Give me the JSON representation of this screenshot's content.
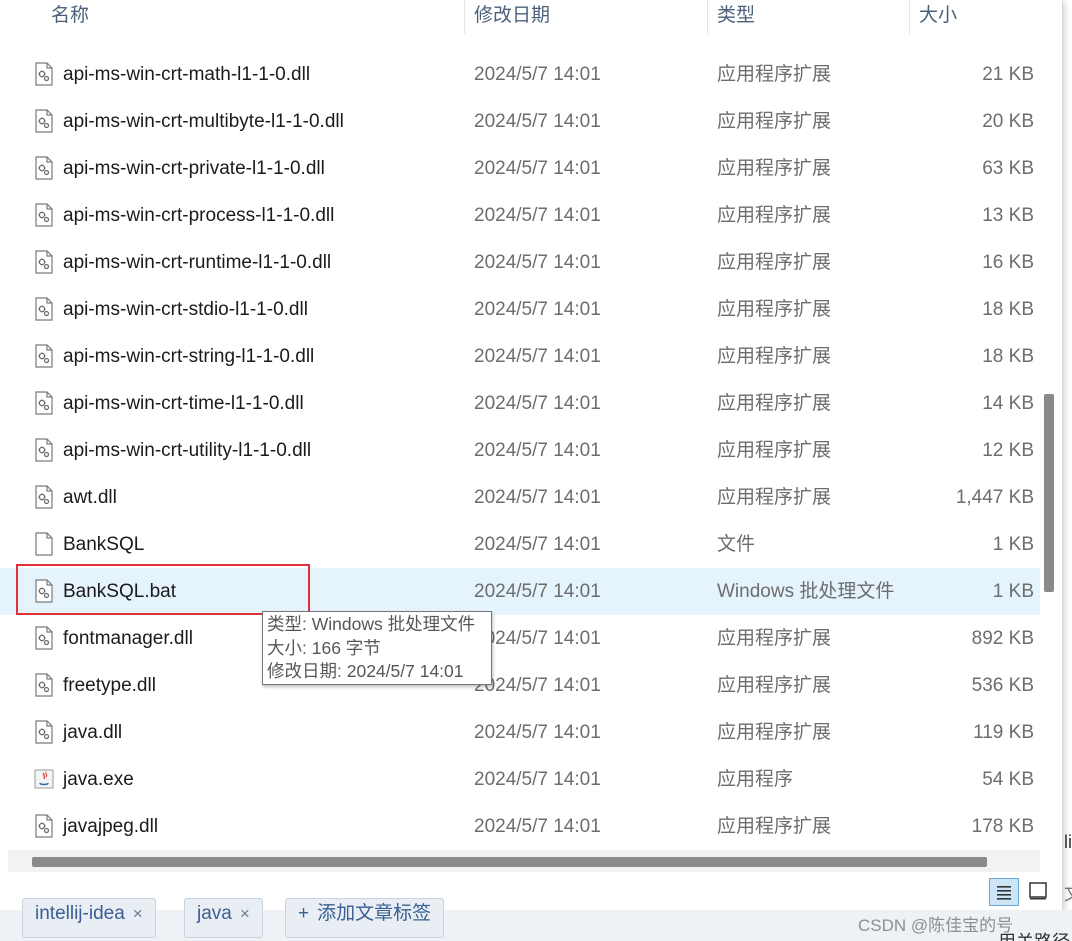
{
  "columns": {
    "name": "名称",
    "date": "修改日期",
    "type": "类型",
    "size": "大小"
  },
  "files": [
    {
      "name": "api-ms-win-crt-math-l1-1-0.dll",
      "date": "2024/5/7 14:01",
      "type": "应用程序扩展",
      "size": "21 KB",
      "icon": "dll-file-icon"
    },
    {
      "name": "api-ms-win-crt-multibyte-l1-1-0.dll",
      "date": "2024/5/7 14:01",
      "type": "应用程序扩展",
      "size": "20 KB",
      "icon": "dll-file-icon"
    },
    {
      "name": "api-ms-win-crt-private-l1-1-0.dll",
      "date": "2024/5/7 14:01",
      "type": "应用程序扩展",
      "size": "63 KB",
      "icon": "dll-file-icon"
    },
    {
      "name": "api-ms-win-crt-process-l1-1-0.dll",
      "date": "2024/5/7 14:01",
      "type": "应用程序扩展",
      "size": "13 KB",
      "icon": "dll-file-icon"
    },
    {
      "name": "api-ms-win-crt-runtime-l1-1-0.dll",
      "date": "2024/5/7 14:01",
      "type": "应用程序扩展",
      "size": "16 KB",
      "icon": "dll-file-icon"
    },
    {
      "name": "api-ms-win-crt-stdio-l1-1-0.dll",
      "date": "2024/5/7 14:01",
      "type": "应用程序扩展",
      "size": "18 KB",
      "icon": "dll-file-icon"
    },
    {
      "name": "api-ms-win-crt-string-l1-1-0.dll",
      "date": "2024/5/7 14:01",
      "type": "应用程序扩展",
      "size": "18 KB",
      "icon": "dll-file-icon"
    },
    {
      "name": "api-ms-win-crt-time-l1-1-0.dll",
      "date": "2024/5/7 14:01",
      "type": "应用程序扩展",
      "size": "14 KB",
      "icon": "dll-file-icon"
    },
    {
      "name": "api-ms-win-crt-utility-l1-1-0.dll",
      "date": "2024/5/7 14:01",
      "type": "应用程序扩展",
      "size": "12 KB",
      "icon": "dll-file-icon"
    },
    {
      "name": "awt.dll",
      "date": "2024/5/7 14:01",
      "type": "应用程序扩展",
      "size": "1,447 KB",
      "icon": "dll-file-icon"
    },
    {
      "name": "BankSQL",
      "date": "2024/5/7 14:01",
      "type": "文件",
      "size": "1 KB",
      "icon": "blank-file-icon"
    },
    {
      "name": "BankSQL.bat",
      "date": "2024/5/7 14:01",
      "type": "Windows 批处理文件",
      "size": "1 KB",
      "icon": "bat-file-icon",
      "selected": true
    },
    {
      "name": "fontmanager.dll",
      "date": "2024/5/7 14:01",
      "type": "应用程序扩展",
      "size": "892 KB",
      "icon": "dll-file-icon"
    },
    {
      "name": "freetype.dll",
      "date": "2024/5/7 14:01",
      "type": "应用程序扩展",
      "size": "536 KB",
      "icon": "dll-file-icon"
    },
    {
      "name": "java.dll",
      "date": "2024/5/7 14:01",
      "type": "应用程序扩展",
      "size": "119 KB",
      "icon": "dll-file-icon"
    },
    {
      "name": "java.exe",
      "date": "2024/5/7 14:01",
      "type": "应用程序",
      "size": "54 KB",
      "icon": "java-exe-icon"
    },
    {
      "name": "javajpeg.dll",
      "date": "2024/5/7 14:01",
      "type": "应用程序扩展",
      "size": "178 KB",
      "icon": "dll-file-icon"
    }
  ],
  "tooltip": {
    "line1": "类型: Windows 批处理文件",
    "line2": "大小: 166 字节",
    "line3": "修改日期: 2024/5/7 14:01"
  },
  "page_tags": [
    {
      "label": "intellij-idea",
      "close": "×"
    },
    {
      "label": "java",
      "close": "×"
    },
    {
      "label": "添加文章标签",
      "prefix": "+"
    }
  ],
  "watermark": "CSDN @陈佳宝的号",
  "edge_fragments": {
    "right_mid": "li",
    "right_low": "文",
    "bottom_right": "用关路径"
  },
  "colors": {
    "selected_row": "#e5f3fd",
    "highlight_border": "#e0313a",
    "header_text": "#4c607a"
  }
}
